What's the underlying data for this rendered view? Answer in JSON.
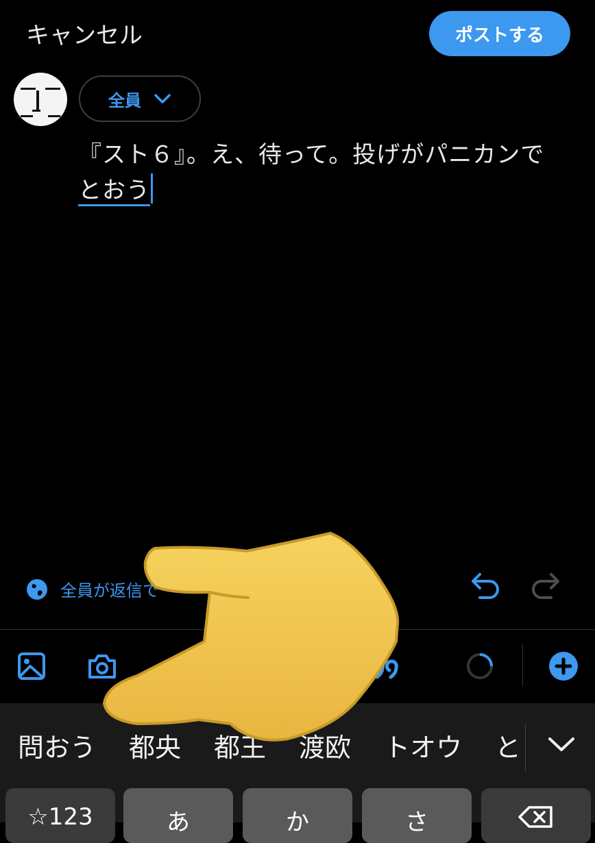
{
  "header": {
    "cancel_label": "キャンセル",
    "post_label": "ポストする"
  },
  "composer": {
    "audience_label": "全員",
    "text_committed": "『スト６』。え、待って。投げがパニカンで",
    "text_composing": "とおう"
  },
  "reply_setting": {
    "label": "全員が返信で"
  },
  "keyboard": {
    "candidates": [
      "問おう",
      "都央",
      "都王",
      "渡欧",
      "トオウ",
      "と"
    ],
    "keys": [
      "☆123",
      "あ",
      "か",
      "さ",
      ""
    ]
  },
  "colors": {
    "accent": "#3d98ef",
    "background": "#000000",
    "text": "#e7e9ea"
  }
}
